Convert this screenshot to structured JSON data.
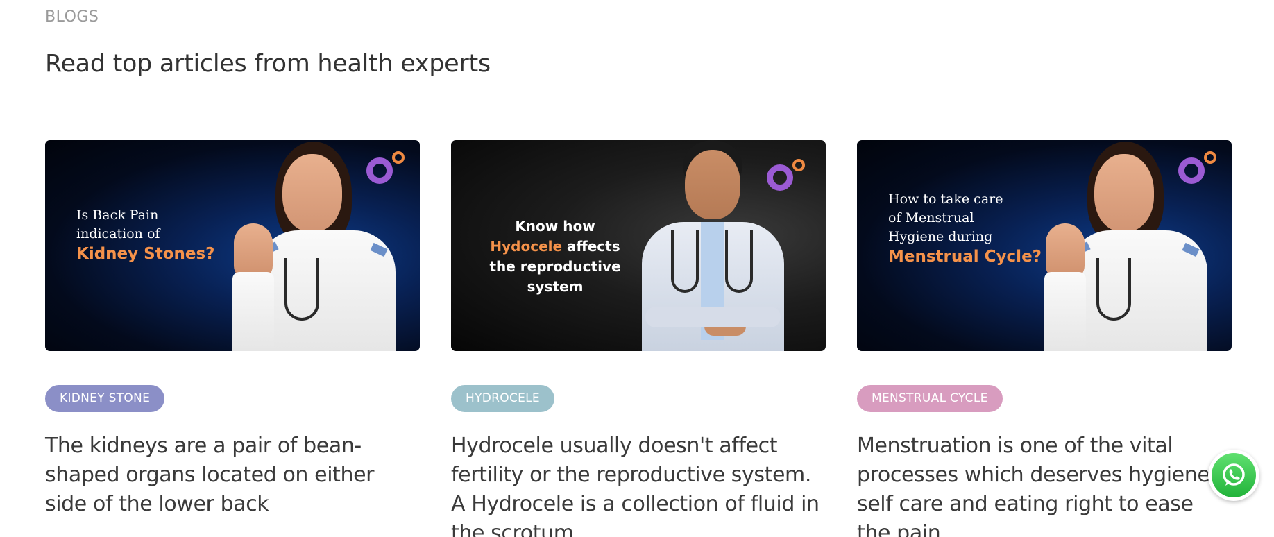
{
  "section": {
    "eyebrow": "BLOGS",
    "title": "Read top articles from health experts"
  },
  "cards": [
    {
      "image_lines": [
        "Is Back Pain",
        "indication of"
      ],
      "image_highlight": "Kidney Stones?",
      "tag": "KIDNEY STONE",
      "tag_color": "#8b8fc7",
      "description": "The kidneys are a pair of bean-shaped organs located on either side of the lower back"
    },
    {
      "image_line1": "Know how",
      "image_highlight": "Hydocele",
      "image_after_highlight": " affects",
      "image_line3": "the reproductive",
      "image_line4": "system",
      "tag": "HYDROCELE",
      "tag_color": "#9cc1cb",
      "description": "Hydrocele usually doesn't affect fertility or the reproductive system. A Hydrocele is a collection of fluid in the scrotum."
    },
    {
      "image_lines": [
        "How to take care",
        "of Menstrual",
        "Hygiene during"
      ],
      "image_highlight": "Menstrual Cycle?",
      "tag": "MENSTRUAL CYCLE",
      "tag_color": "#d89cbf",
      "description": "Menstruation is one of the vital processes which deserves hygiene, self care and eating right to ease the pain."
    }
  ],
  "icons": {
    "brand_logo": "brand-logo-icon",
    "whatsapp": "whatsapp-icon"
  },
  "colors": {
    "accent_orange": "#f5924a",
    "logo_purple": "#9b5bd4"
  }
}
